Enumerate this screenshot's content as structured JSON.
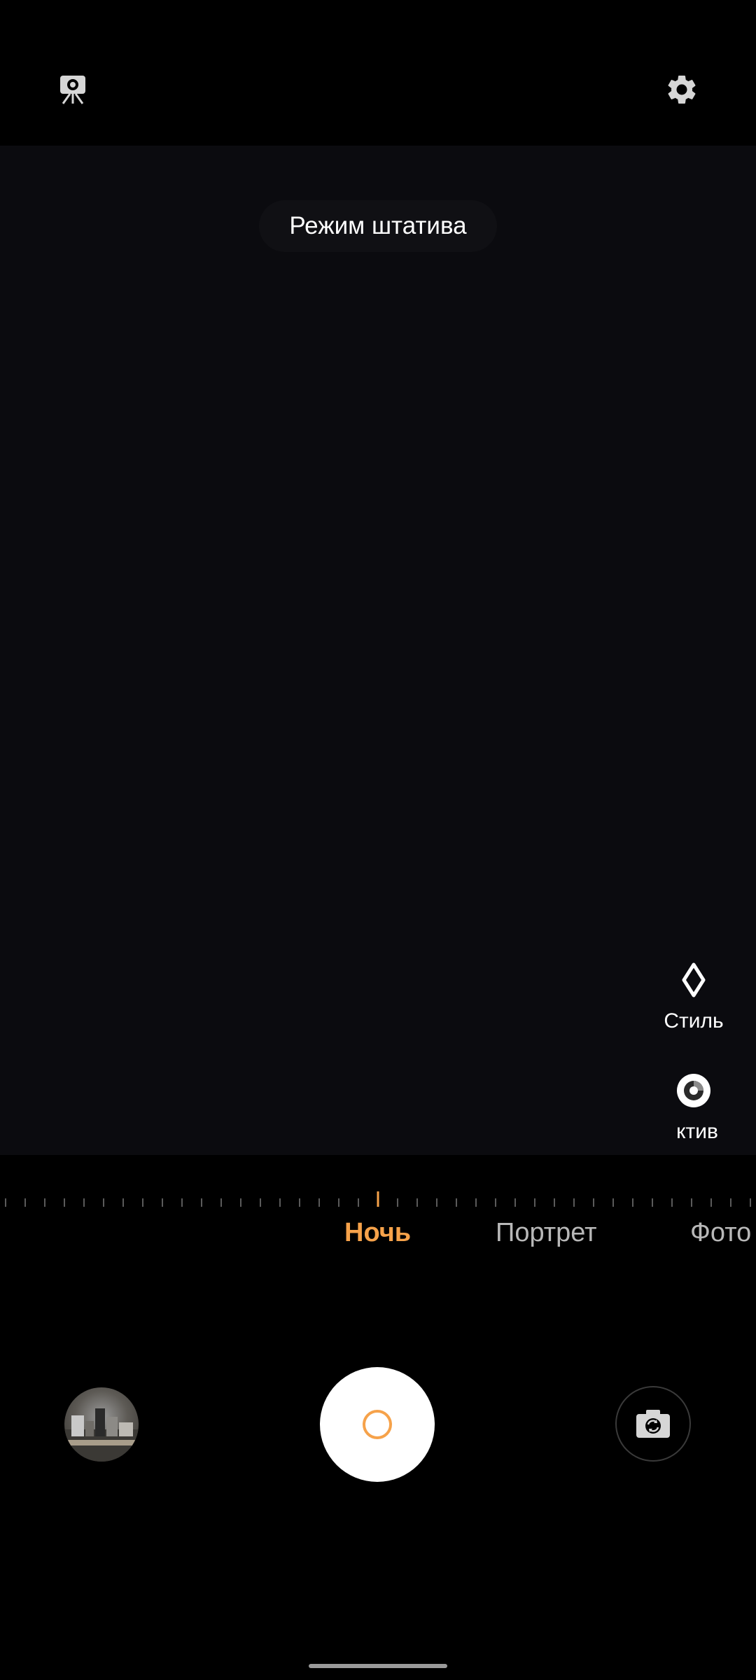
{
  "top_bar": {
    "tripod_icon": "tripod-mode-icon",
    "settings_icon": "gear-icon"
  },
  "viewfinder": {
    "toast_text": "Режим штатива"
  },
  "side_tools": {
    "style_label": "Стиль",
    "style_icon": "sparkle-icon",
    "lens_label": "ктив",
    "lens_icon": "lens-icon"
  },
  "modes": {
    "items": [
      "Ночь",
      "Портрет",
      "Фото"
    ],
    "active": "Ночь",
    "active_color": "#f6a24a",
    "inactive_color": "#b8b8b8"
  },
  "controls": {
    "gallery_icon": "gallery-thumbnail",
    "shutter_icon": "shutter-button",
    "flip_icon": "switch-camera-icon"
  }
}
